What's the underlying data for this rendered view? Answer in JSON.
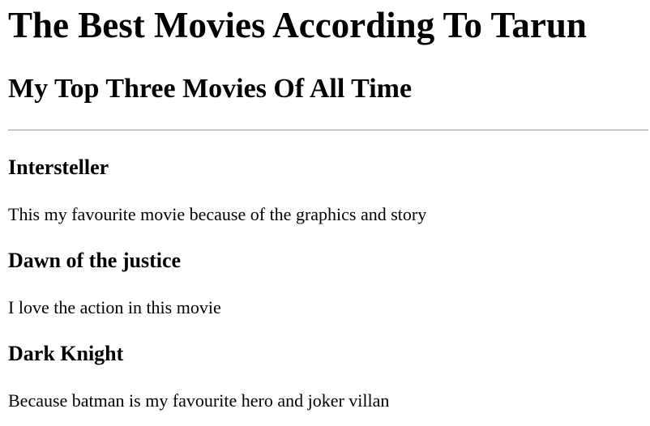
{
  "page": {
    "title": "The Best Movies According To Tarun",
    "subtitle": "My Top Three Movies Of All Time"
  },
  "movies": [
    {
      "title": "Intersteller",
      "description": "This my favourite movie because of the graphics and story"
    },
    {
      "title": "Dawn of the justice",
      "description": "I love the action in this movie"
    },
    {
      "title": "Dark Knight",
      "description": "Because batman is my favourite hero and joker villan"
    }
  ]
}
